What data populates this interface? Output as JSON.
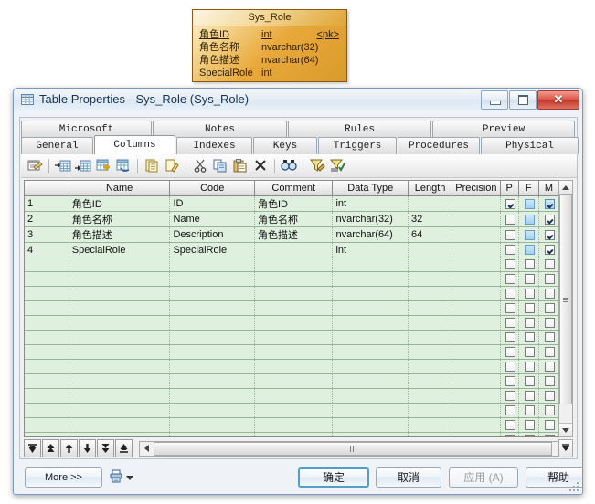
{
  "entity": {
    "title": "Sys_Role",
    "columns": [
      {
        "name": "角色ID",
        "type": "int",
        "mark": "<pk>",
        "pk": true
      },
      {
        "name": "角色名称",
        "type": "nvarchar(32)",
        "mark": "",
        "pk": false
      },
      {
        "name": "角色描述",
        "type": "nvarchar(64)",
        "mark": "",
        "pk": false
      },
      {
        "name": "SpecialRole",
        "type": "int",
        "mark": "",
        "pk": false
      }
    ]
  },
  "window": {
    "title": "Table Properties - Sys_Role (Sys_Role)",
    "icon": "table-icon",
    "minimize_label": "",
    "maximize_label": "",
    "close_label": "✕"
  },
  "tabs": {
    "row1": [
      {
        "label": "Microsoft",
        "active": false
      },
      {
        "label": "Notes",
        "active": false
      },
      {
        "label": "Rules",
        "active": false
      },
      {
        "label": "Preview",
        "active": false
      }
    ],
    "row2": [
      {
        "label": "General",
        "active": false
      },
      {
        "label": "Columns",
        "active": true
      },
      {
        "label": "Indexes",
        "active": false
      },
      {
        "label": "Keys",
        "active": false
      },
      {
        "label": "Triggers",
        "active": false
      },
      {
        "label": "Procedures",
        "active": false
      },
      {
        "label": "Physical Options",
        "active": false
      }
    ]
  },
  "toolbar": {
    "items": [
      {
        "name": "properties-icon"
      },
      {
        "name": "insert-row-icon"
      },
      {
        "name": "add-row-icon"
      },
      {
        "name": "add-a-column-icon"
      },
      {
        "name": "show-columns-icon"
      },
      {
        "name": "duplicate-icon"
      },
      {
        "name": "clear-icon"
      },
      {
        "name": "cut-icon"
      },
      {
        "name": "copy-icon"
      },
      {
        "name": "paste-icon"
      },
      {
        "name": "delete-icon"
      },
      {
        "name": "find-icon"
      },
      {
        "name": "filter-icon"
      },
      {
        "name": "apply-filter-icon"
      }
    ]
  },
  "grid": {
    "headers": [
      "",
      "Name",
      "Code",
      "Comment",
      "Data Type",
      "Length",
      "Precision",
      "P",
      "F",
      "M"
    ],
    "rows": [
      {
        "num": "1",
        "name": "角色ID",
        "code": "ID",
        "comment": "角色ID",
        "datatype": "int",
        "length": "",
        "precision": "",
        "p": true,
        "f": false,
        "m": true
      },
      {
        "num": "2",
        "name": "角色名称",
        "code": "Name",
        "comment": "角色名称",
        "datatype": "nvarchar(32)",
        "length": "32",
        "precision": "",
        "p": false,
        "f": false,
        "m": true
      },
      {
        "num": "3",
        "name": "角色描述",
        "code": "Description",
        "comment": "角色描述",
        "datatype": "nvarchar(64)",
        "length": "64",
        "precision": "",
        "p": false,
        "f": false,
        "m": true
      },
      {
        "num": "4",
        "name": "SpecialRole",
        "code": "SpecialRole",
        "comment": "",
        "datatype": "int",
        "length": "",
        "precision": "",
        "p": false,
        "f": false,
        "m": true
      }
    ],
    "empty_row_count": 13
  },
  "nav": {
    "buttons": [
      {
        "name": "go-first-button"
      },
      {
        "name": "page-up-button"
      },
      {
        "name": "move-up-button"
      },
      {
        "name": "move-down-button"
      },
      {
        "name": "page-down-button"
      },
      {
        "name": "go-last-button"
      }
    ]
  },
  "footer": {
    "more_label": "More >>",
    "print_icon": "print-icon",
    "ok_label": "确定",
    "cancel_label": "取消",
    "apply_label": "应用 (A)",
    "help_label": "帮助"
  },
  "colors": {
    "entity_fill": "#e3a53a",
    "grid_fill": "#dff0df",
    "accent": "#4f9ecb",
    "close_red": "#c33a28"
  }
}
